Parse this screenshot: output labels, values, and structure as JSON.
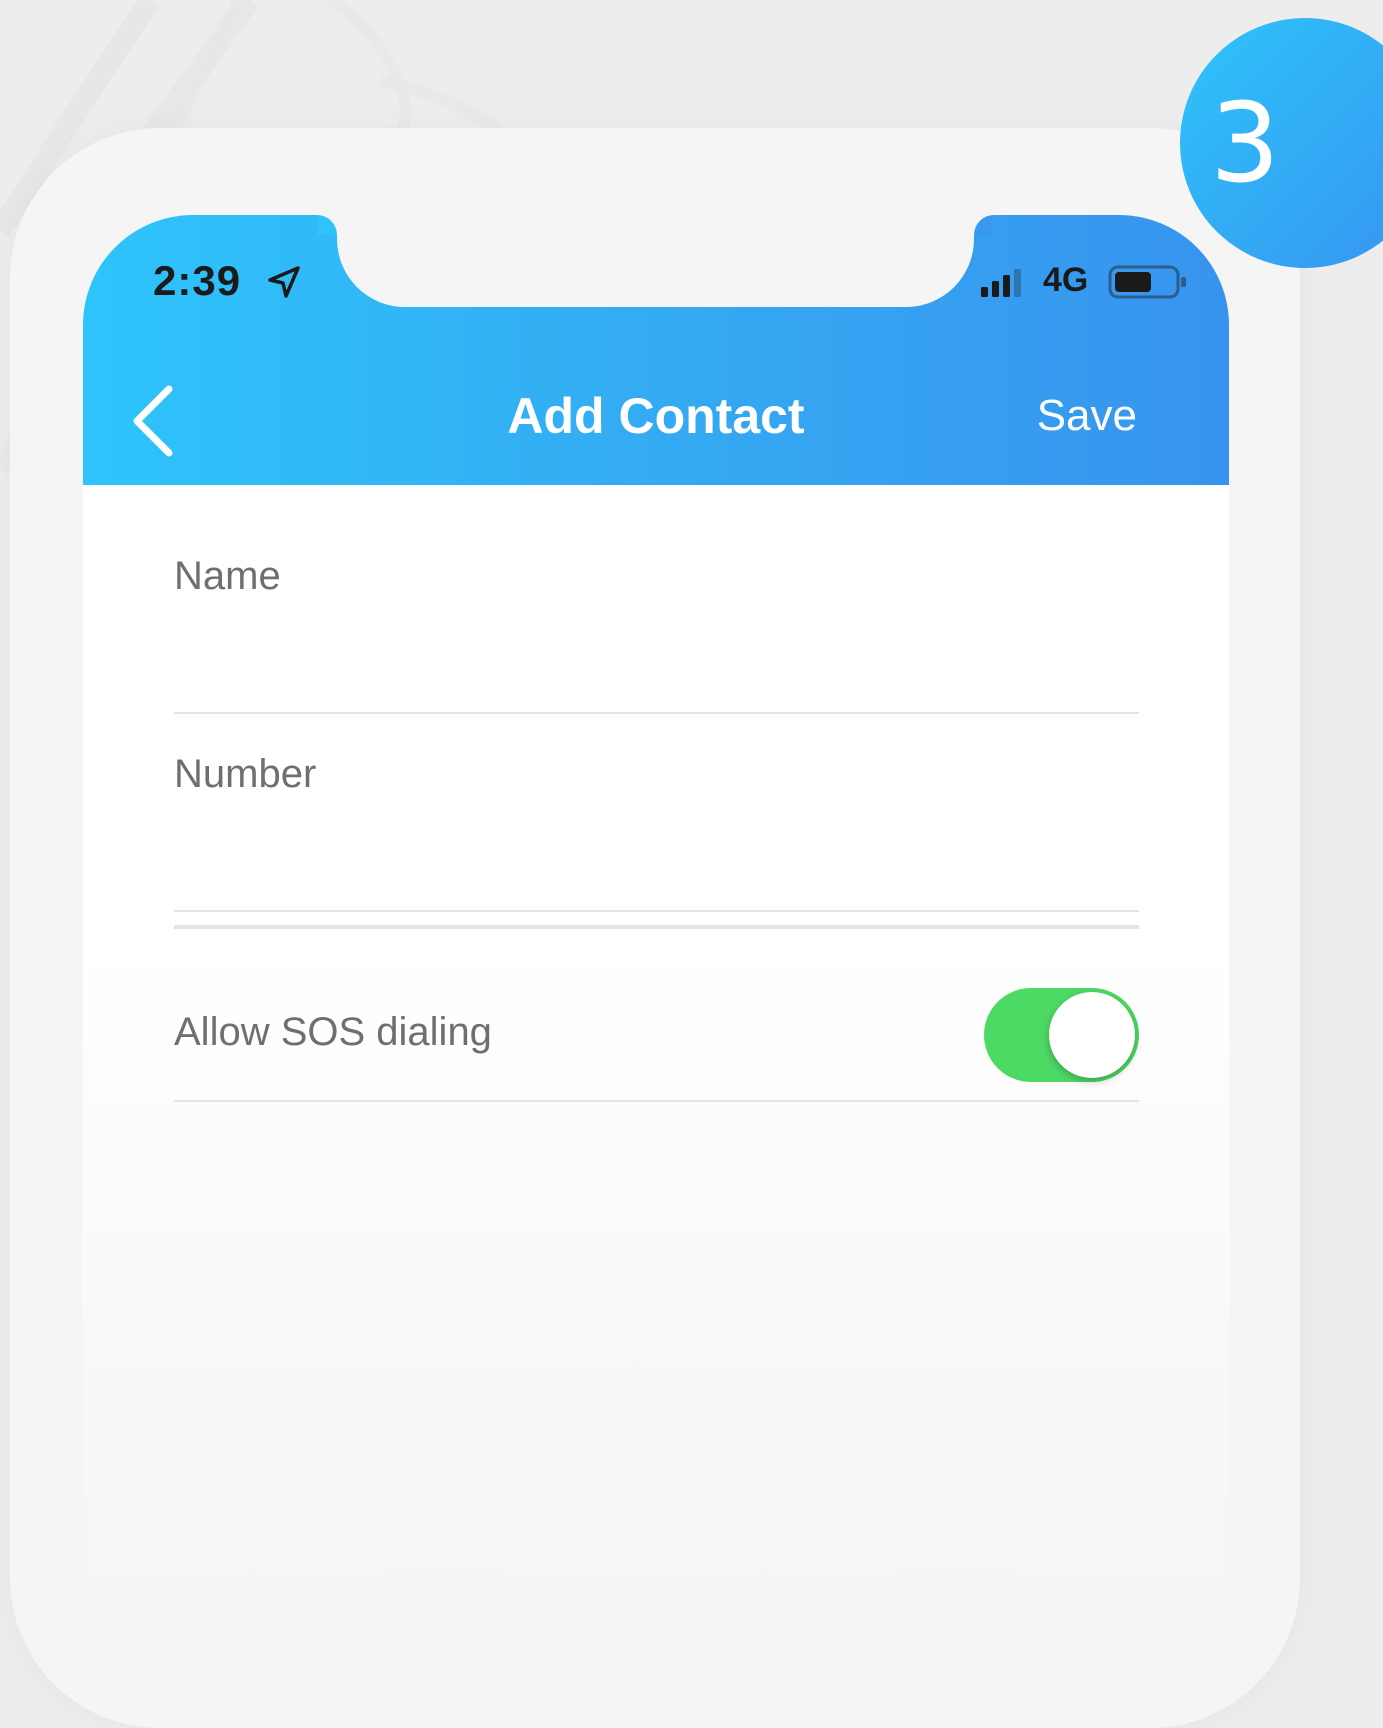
{
  "step_badge": {
    "number": "3"
  },
  "status_bar": {
    "time": "2:39",
    "location_icon": "location-arrow-icon",
    "signal_icon": "cellular-signal-icon",
    "network": "4G",
    "battery_icon": "battery-icon"
  },
  "nav": {
    "back_icon": "chevron-left-icon",
    "title": "Add Contact",
    "save_label": "Save"
  },
  "form": {
    "name_label": "Name",
    "name_value": "",
    "number_label": "Number",
    "number_value": "",
    "sos_label": "Allow SOS dialing",
    "sos_enabled": true
  },
  "colors": {
    "header_start": "#2ec4fb",
    "header_end": "#3794ee",
    "toggle_on": "#4cd964",
    "label_text": "#6f6f6f"
  }
}
